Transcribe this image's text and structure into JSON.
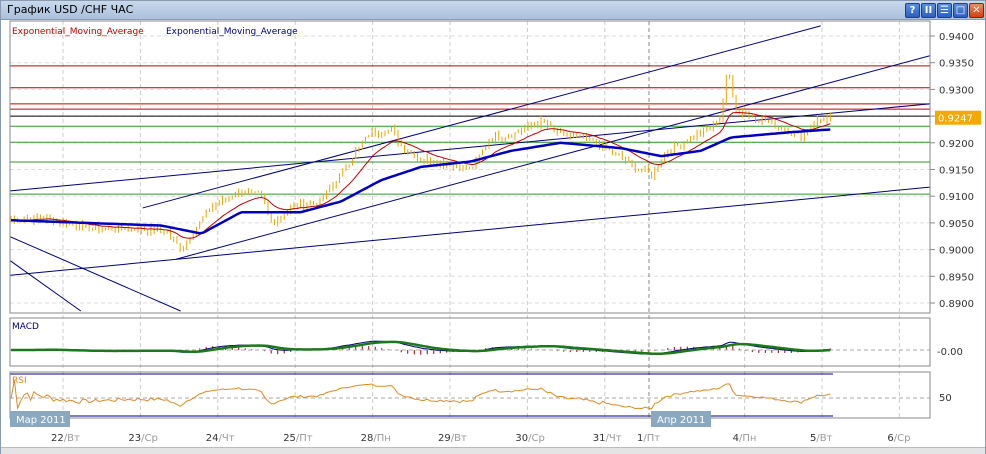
{
  "window": {
    "title": "График USD /CHF  ЧАС",
    "buttons": [
      "?",
      "II",
      "☰",
      "□",
      "✕"
    ]
  },
  "legend": {
    "red": "Exponential_Moving_Average",
    "blue": "Exponential_Moving_Average"
  },
  "colors": {
    "candle": "#e8a800",
    "ema_fast": "#c00000",
    "ema_slow": "#0000a0",
    "macd": "#000080",
    "signal": "#1a7a1a",
    "rsi": "#e08a20",
    "price_badge": "#f5a800",
    "level_red": "#c00000",
    "level_green": "#2a9a2a",
    "trend": "#000080"
  },
  "price_axis": {
    "ticks": [
      "0.9400",
      "0.9350",
      "0.9300",
      "0.9250",
      "0.9200",
      "0.9150",
      "0.9100",
      "0.9050",
      "0.9000",
      "0.8950",
      "0.8900"
    ],
    "current": "0.9247"
  },
  "macd": {
    "label": "MACD",
    "axis": "-0.00"
  },
  "rsi": {
    "label": "RSI",
    "axis": "50"
  },
  "time_axis": {
    "days": [
      {
        "n": "22",
        "w": "Вт"
      },
      {
        "n": "23",
        "w": "Ср"
      },
      {
        "n": "24",
        "w": "Чт"
      },
      {
        "n": "25",
        "w": "Пт"
      },
      {
        "n": "28",
        "w": "Пн"
      },
      {
        "n": "29",
        "w": "Вт"
      },
      {
        "n": "30",
        "w": "Ср"
      },
      {
        "n": "31",
        "w": "Чт"
      },
      {
        "n": "1",
        "w": "Пт"
      },
      {
        "n": "4",
        "w": "Пн"
      },
      {
        "n": "5",
        "w": "Вт"
      },
      {
        "n": "6",
        "w": "Ср"
      }
    ],
    "months": [
      "Мар 2011",
      "Апр 2011"
    ]
  },
  "chart_data": {
    "type": "candlestick",
    "title": "USD/CHF hourly",
    "ylim": [
      0.888,
      0.942
    ],
    "close_path": [
      [
        -0.67,
        0.9055
      ],
      [
        -0.28,
        0.906
      ],
      [
        0.36,
        0.904
      ],
      [
        0.88,
        0.904
      ],
      [
        1.33,
        0.9035
      ],
      [
        1.52,
        0.9
      ],
      [
        1.72,
        0.904
      ],
      [
        1.91,
        0.908
      ],
      [
        2.3,
        0.911
      ],
      [
        2.56,
        0.91
      ],
      [
        2.69,
        0.905
      ],
      [
        2.95,
        0.908
      ],
      [
        3.33,
        0.909
      ],
      [
        3.53,
        0.913
      ],
      [
        3.72,
        0.917
      ],
      [
        3.98,
        0.922
      ],
      [
        4.24,
        0.9225
      ],
      [
        4.37,
        0.9195
      ],
      [
        4.63,
        0.917
      ],
      [
        5.01,
        0.916
      ],
      [
        5.27,
        0.915
      ],
      [
        5.53,
        0.921
      ],
      [
        5.79,
        0.9215
      ],
      [
        6.18,
        0.924
      ],
      [
        6.43,
        0.9215
      ],
      [
        6.69,
        0.921
      ],
      [
        6.95,
        0.9195
      ],
      [
        7.34,
        0.916
      ],
      [
        7.6,
        0.914
      ],
      [
        7.79,
        0.918
      ],
      [
        8.11,
        0.921
      ],
      [
        8.37,
        0.923
      ],
      [
        8.5,
        0.925
      ],
      [
        8.59,
        0.934
      ],
      [
        8.7,
        0.926
      ],
      [
        9.02,
        0.9245
      ],
      [
        9.41,
        0.922
      ],
      [
        9.53,
        0.921
      ],
      [
        9.73,
        0.924
      ],
      [
        9.92,
        0.9247
      ]
    ],
    "ema_slow": [
      [
        -0.67,
        0.9055
      ],
      [
        1.27,
        0.9045
      ],
      [
        1.79,
        0.903
      ],
      [
        2.3,
        0.907
      ],
      [
        3.07,
        0.907
      ],
      [
        3.59,
        0.909
      ],
      [
        4.11,
        0.913
      ],
      [
        4.63,
        0.9155
      ],
      [
        5.27,
        0.9165
      ],
      [
        5.79,
        0.9185
      ],
      [
        6.43,
        0.92
      ],
      [
        7.21,
        0.919
      ],
      [
        7.73,
        0.9175
      ],
      [
        8.24,
        0.9185
      ],
      [
        8.63,
        0.921
      ],
      [
        9.41,
        0.922
      ],
      [
        9.92,
        0.9225
      ]
    ],
    "levels_red": [
      0.9344,
      0.9303,
      0.9273,
      0.9263
    ],
    "level_black": 0.925,
    "levels_green": [
      0.9231,
      0.9201,
      0.9164,
      0.9104
    ],
    "trendlines": [
      [
        [
          -0.68,
          0.911
        ],
        [
          11.2,
          0.9273
        ]
      ],
      [
        [
          1.03,
          0.9078
        ],
        [
          9.79,
          0.9419
        ]
      ],
      [
        [
          1.46,
          0.8982
        ],
        [
          11.2,
          0.9363
        ]
      ],
      [
        [
          -0.68,
          0.8952
        ],
        [
          11.2,
          0.9117
        ]
      ],
      [
        [
          -0.68,
          0.9024
        ],
        [
          1.52,
          0.8885
        ]
      ],
      [
        [
          -0.68,
          0.8979
        ],
        [
          0.23,
          0.8885
        ]
      ]
    ]
  }
}
